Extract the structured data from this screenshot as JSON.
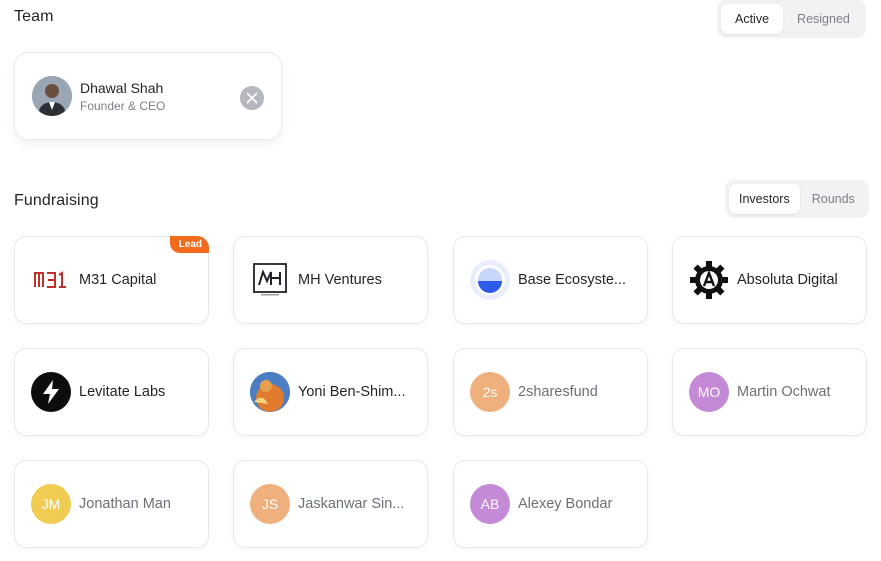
{
  "team": {
    "title": "Team",
    "tabs": [
      {
        "label": "Active",
        "active": true
      },
      {
        "label": "Resigned",
        "active": false
      }
    ],
    "members": [
      {
        "name": "Dhawal Shah",
        "role": "Founder & CEO",
        "social_icon": "x-icon"
      }
    ]
  },
  "fundraising": {
    "title": "Fundraising",
    "tabs": [
      {
        "label": "Investors",
        "active": true
      },
      {
        "label": "Rounds",
        "active": false
      }
    ],
    "investors": [
      {
        "name": "M31 Capital",
        "badge": "Lead",
        "logo": "m31-logo"
      },
      {
        "name": "MH Ventures",
        "logo": "mh-logo"
      },
      {
        "name": "Base Ecosyste...",
        "logo": "base-logo"
      },
      {
        "name": "Absoluta Digital",
        "logo": "gear-logo"
      },
      {
        "name": "Levitate Labs",
        "logo": "bolt-logo"
      },
      {
        "name": "Yoni Ben-Shim...",
        "logo": "photo-avatar"
      },
      {
        "name": "2sharesfund",
        "initials": "2s",
        "color": "#f0b07e"
      },
      {
        "name": "Martin Ochwat",
        "initials": "MO",
        "color": "#c58ad6"
      },
      {
        "name": "Jonathan Man",
        "initials": "JM",
        "color": "#f0cc52"
      },
      {
        "name": "Jaskanwar Sin...",
        "initials": "JS",
        "color": "#f0b07e"
      },
      {
        "name": "Alexey Bondar",
        "initials": "AB",
        "color": "#c58ad6"
      }
    ]
  },
  "colors": {
    "lead_badge": "#f26b1d",
    "card_border": "#e6e8ec",
    "muted_text": "#6b7078"
  }
}
